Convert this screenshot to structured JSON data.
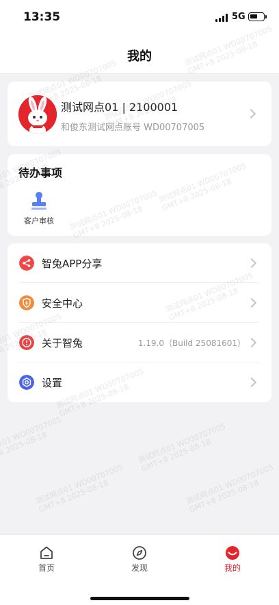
{
  "status_bar": {
    "time": "13:35",
    "network": "5G"
  },
  "nav": {
    "title": "我的"
  },
  "profile": {
    "name": "测试网点01 | 2100001",
    "subtitle": "和俊东测试网点账号 WD00707005"
  },
  "todo": {
    "title": "待办事项",
    "items": [
      {
        "label": "客户审核",
        "icon": "stamp-icon"
      }
    ]
  },
  "menu": {
    "items": [
      {
        "label": "智兔APP分享",
        "value": "",
        "icon": "share-icon",
        "color": "#f04646"
      },
      {
        "label": "安全中心",
        "value": "",
        "icon": "shield-icon",
        "color": "#f08a3c"
      },
      {
        "label": "关于智兔",
        "value": "1.19.0（Build 25081601）",
        "icon": "info-icon",
        "color": "#ea4444"
      },
      {
        "label": "设置",
        "value": "",
        "icon": "gear-icon",
        "color": "#4a63e8"
      }
    ]
  },
  "tabbar": {
    "items": [
      {
        "label": "首页",
        "icon": "home-icon",
        "active": false
      },
      {
        "label": "发现",
        "icon": "compass-icon",
        "active": false
      },
      {
        "label": "我的",
        "icon": "profile-icon",
        "active": true
      }
    ]
  },
  "watermark": {
    "line1": "测试网点01 WD00707005",
    "line2": "GMT+8 2025-08-18"
  },
  "colors": {
    "accent": "#e4262c",
    "background": "#f2f2f4"
  }
}
